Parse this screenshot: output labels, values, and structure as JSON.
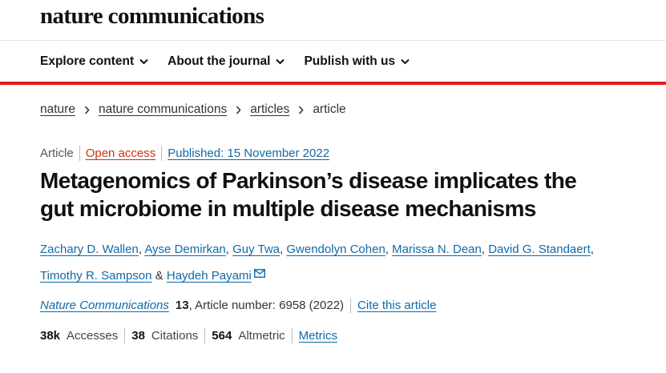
{
  "header": {
    "logo": "nature communications"
  },
  "nav": {
    "items": [
      {
        "label": "Explore content"
      },
      {
        "label": "About the journal"
      },
      {
        "label": "Publish with us"
      }
    ]
  },
  "breadcrumb": [
    {
      "label": "nature"
    },
    {
      "label": "nature communications"
    },
    {
      "label": "articles"
    },
    {
      "label": "article"
    }
  ],
  "article": {
    "type": "Article",
    "access": "Open access",
    "published": "Published: 15 November 2022",
    "title_line1": "Metagenomics of Parkinson’s disease implicates the",
    "title_line2": "gut microbiome in multiple disease mechanisms",
    "authors": [
      "Zachary D. Wallen",
      "Ayse Demirkan",
      "Guy Twa",
      "Gwendolyn Cohen",
      "Marissa N. Dean",
      "David G. Standaert",
      "Timothy R. Sampson",
      "Haydeh Payami"
    ],
    "comma": ",",
    "ampersand": "&",
    "journal": "Nature Communications",
    "volume": "13",
    "article_number": ", Article number: 6958 (2022)",
    "cite_label": "Cite this article"
  },
  "metrics": {
    "accesses_value": "38k",
    "accesses_label": "Accesses",
    "citations_value": "38",
    "citations_label": "Citations",
    "altmetric_value": "564",
    "altmetric_label": "Altmetric",
    "link_label": "Metrics"
  },
  "colors": {
    "accent_red": "#e11c22",
    "link_blue": "#0f6aa8",
    "open_access_orange": "#c7370f"
  }
}
